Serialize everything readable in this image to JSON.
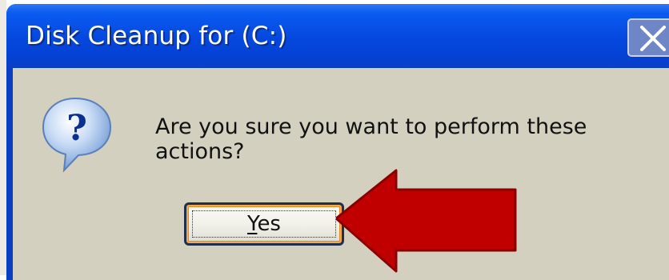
{
  "window": {
    "title": "Disk Cleanup for  (C:)"
  },
  "dialog": {
    "message": "Are you sure you want to perform these actions?",
    "icon": "question-icon"
  },
  "buttons": {
    "yes_prefix": "Y",
    "yes_rest": "es"
  },
  "annotation": {
    "arrow_color": "#cc0000",
    "arrow_icon": "red-arrow-icon"
  },
  "colors": {
    "titlebar": "#0547de",
    "client": "#d4d0c0"
  }
}
